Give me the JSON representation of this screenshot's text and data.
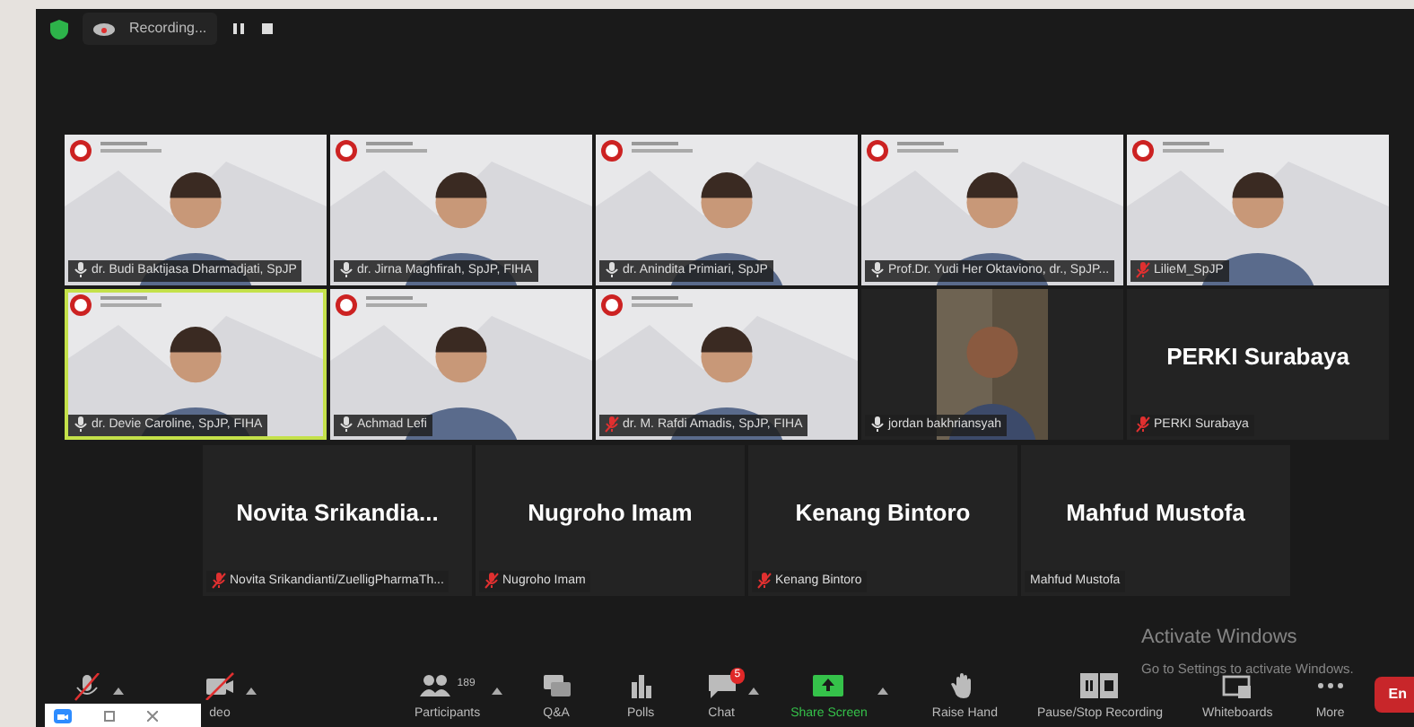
{
  "top_bar": {
    "recording": {
      "label": "Recording..."
    }
  },
  "gallery": [
    [
      {
        "kind": "video",
        "name": "dr. Budi Baktijasa Dharmadjati, SpJP",
        "muted": false,
        "speaking": false
      },
      {
        "kind": "video",
        "name": "dr. Jirna Maghfirah, SpJP, FIHA",
        "muted": false,
        "speaking": false
      },
      {
        "kind": "video",
        "name": "dr. Anindita Primiari, SpJP",
        "muted": false,
        "speaking": false
      },
      {
        "kind": "video",
        "name": "Prof.Dr. Yudi Her Oktaviono, dr., SpJP...",
        "muted": false,
        "speaking": false
      },
      {
        "kind": "video",
        "name": "LilieM_SpJP",
        "muted": true,
        "speaking": false
      }
    ],
    [
      {
        "kind": "video",
        "name": "dr. Devie Caroline, SpJP, FIHA",
        "muted": false,
        "speaking": true
      },
      {
        "kind": "video",
        "name": "Achmad Lefi",
        "muted": false,
        "speaking": false
      },
      {
        "kind": "video",
        "name": "dr. M. Rafdi Amadis, SpJP, FIHA",
        "muted": true,
        "speaking": false
      },
      {
        "kind": "narrow-video",
        "name": "jordan bakhriansyah",
        "muted": false,
        "speaking": false
      },
      {
        "kind": "name",
        "title": "PERKI Surabaya",
        "name": "PERKI Surabaya",
        "muted": true,
        "speaking": false
      }
    ],
    [
      {
        "kind": "name",
        "title": "Novita  Srikandia...",
        "name": "Novita Srikandianti/ZuelligPharmaTh...",
        "muted": true,
        "speaking": false
      },
      {
        "kind": "name",
        "title": "Nugroho Imam",
        "name": "Nugroho Imam",
        "muted": true,
        "speaking": false
      },
      {
        "kind": "name",
        "title": "Kenang Bintoro",
        "name": "Kenang Bintoro",
        "muted": true,
        "speaking": false
      },
      {
        "kind": "name",
        "title": "Mahfud Mustofa",
        "name": "Mahfud Mustofa",
        "speaking": false
      }
    ]
  ],
  "toolbar": [
    {
      "kind": "mic",
      "caret": true
    },
    {
      "kind": "video",
      "label": "deo",
      "caret": true
    },
    {
      "kind": "participants",
      "label": "Participants",
      "count": "189",
      "caret": true
    },
    {
      "kind": "qa",
      "label": "Q&A"
    },
    {
      "kind": "polls",
      "label": "Polls"
    },
    {
      "kind": "chat",
      "label": "Chat",
      "badge": "5",
      "caret": true
    },
    {
      "kind": "share",
      "label": "Share Screen",
      "caret": true
    },
    {
      "kind": "hand",
      "label": "Raise Hand"
    },
    {
      "kind": "record",
      "label": "Pause/Stop Recording"
    },
    {
      "kind": "whiteboard",
      "label": "Whiteboards"
    },
    {
      "kind": "more",
      "label": "More"
    }
  ],
  "end_button": "En",
  "activation": {
    "title": "Activate Windows",
    "message": "Go to Settings to activate Windows."
  }
}
